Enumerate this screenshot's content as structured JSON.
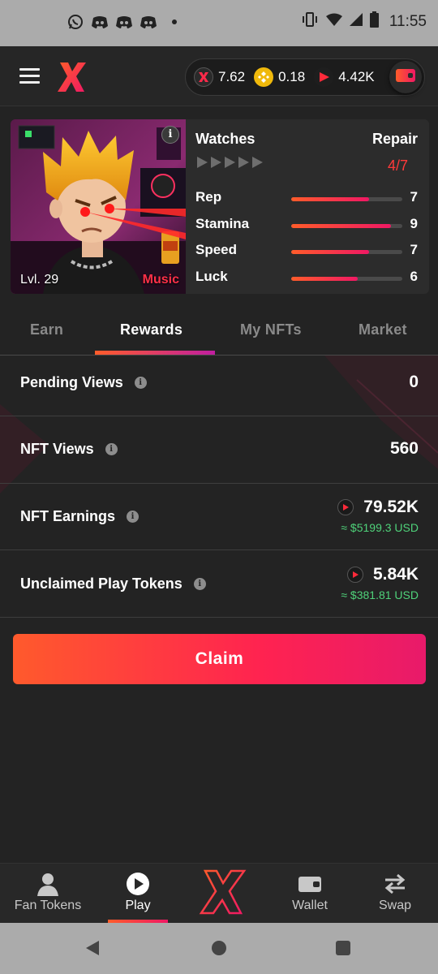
{
  "status_bar": {
    "time": "11:55",
    "left_icons": [
      "whatsapp-icon",
      "discord-icon",
      "discord-icon",
      "discord-icon",
      "dot-icon"
    ],
    "right_icons": [
      "vibrate-icon",
      "wifi-icon",
      "signal-icon",
      "battery-icon"
    ]
  },
  "header": {
    "logo": "X",
    "balances": [
      {
        "icon": "x-token-icon",
        "value": "7.62"
      },
      {
        "icon": "bnb-coin-icon",
        "value": "0.18"
      },
      {
        "icon": "play-token-icon",
        "value": "4.42K"
      }
    ]
  },
  "nft": {
    "level": "Lvl. 29",
    "genre": "Music",
    "category": "Watches",
    "repair_label": "Repair",
    "repair_count": "4/7",
    "stars_total": 5,
    "stats": [
      {
        "label": "Rep",
        "value": "7",
        "level": 0.7
      },
      {
        "label": "Stamina",
        "value": "9",
        "level": 0.9
      },
      {
        "label": "Speed",
        "value": "7",
        "level": 0.7
      },
      {
        "label": "Luck",
        "value": "6",
        "level": 0.6
      }
    ]
  },
  "tabs": [
    {
      "label": "Earn",
      "active": false
    },
    {
      "label": "Rewards",
      "active": true
    },
    {
      "label": "My NFTs",
      "active": false
    },
    {
      "label": "Market",
      "active": false
    }
  ],
  "rewards": {
    "pending_views": {
      "label": "Pending Views",
      "value": "0"
    },
    "nft_views": {
      "label": "NFT Views",
      "value": "560"
    },
    "nft_earnings": {
      "label": "NFT Earnings",
      "value": "79.52K",
      "usd": "≈ $5199.3 USD"
    },
    "unclaimed": {
      "label": "Unclaimed Play Tokens",
      "value": "5.84K",
      "usd": "≈ $381.81 USD"
    },
    "claim_label": "Claim"
  },
  "bottom_nav": [
    {
      "label": "Fan Tokens",
      "icon": "person-icon"
    },
    {
      "label": "Play",
      "icon": "play-circle-icon",
      "active": true
    },
    {
      "label": "",
      "icon": "x-logo-icon"
    },
    {
      "label": "Wallet",
      "icon": "wallet-icon"
    },
    {
      "label": "Swap",
      "icon": "swap-icon"
    }
  ],
  "colors": {
    "accent_orange": "#ff5c2a",
    "accent_pink": "#f01864",
    "usd_green": "#4fd27a",
    "repair_red": "#ff3a3a",
    "background": "#232323"
  }
}
